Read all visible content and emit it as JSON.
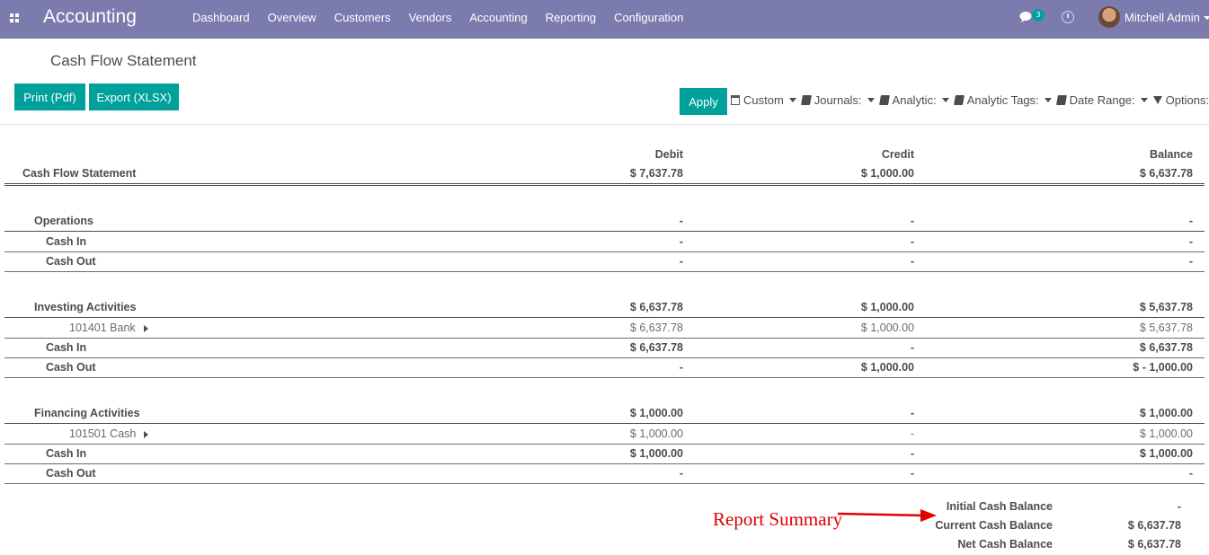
{
  "navbar": {
    "app_title": "Accounting",
    "menu": [
      "Dashboard",
      "Overview",
      "Customers",
      "Vendors",
      "Accounting",
      "Reporting",
      "Configuration"
    ],
    "chat_count": "3",
    "user_name": "Mitchell Admin"
  },
  "page": {
    "title": "Cash Flow Statement",
    "print_label": "Print (Pdf)",
    "export_label": "Export (XLSX)",
    "apply_label": "Apply",
    "filters": [
      "Custom",
      "Journals:",
      "Analytic:",
      "Analytic Tags:",
      "Date Range:",
      "Options:"
    ]
  },
  "report": {
    "columns": [
      "Debit",
      "Credit",
      "Balance"
    ],
    "rows": [
      {
        "label": "Cash Flow Statement",
        "debit": "$ 7,637.78",
        "credit": "$ 1,000.00",
        "balance": "$ 6,637.78",
        "style": "title"
      },
      {
        "label": "Operations",
        "debit": "-",
        "credit": "-",
        "balance": "-",
        "style": "section"
      },
      {
        "label": "Cash In",
        "debit": "-",
        "credit": "-",
        "balance": "-",
        "style": "sub"
      },
      {
        "label": "Cash Out",
        "debit": "-",
        "credit": "-",
        "balance": "-",
        "style": "sub"
      },
      {
        "label": "Investing Activities",
        "debit": "$ 6,637.78",
        "credit": "$ 1,000.00",
        "balance": "$ 5,637.78",
        "style": "section"
      },
      {
        "label": "101401 Bank",
        "debit": "$ 6,637.78",
        "credit": "$ 1,000.00",
        "balance": "$ 5,637.78",
        "style": "account"
      },
      {
        "label": "Cash In",
        "debit": "$ 6,637.78",
        "credit": "-",
        "balance": "$ 6,637.78",
        "style": "sub"
      },
      {
        "label": "Cash Out",
        "debit": "-",
        "credit": "$ 1,000.00",
        "balance": "$ - 1,000.00",
        "style": "sub"
      },
      {
        "label": "Financing Activities",
        "debit": "$ 1,000.00",
        "credit": "-",
        "balance": "$ 1,000.00",
        "style": "section"
      },
      {
        "label": "101501 Cash",
        "debit": "$ 1,000.00",
        "credit": "-",
        "balance": "$ 1,000.00",
        "style": "account"
      },
      {
        "label": "Cash In",
        "debit": "$ 1,000.00",
        "credit": "-",
        "balance": "$ 1,000.00",
        "style": "sub"
      },
      {
        "label": "Cash Out",
        "debit": "-",
        "credit": "-",
        "balance": "-",
        "style": "sub"
      }
    ],
    "summary": [
      {
        "label": "Initial Cash Balance",
        "value": "-"
      },
      {
        "label": "Current Cash Balance",
        "value": "$ 6,637.78"
      },
      {
        "label": "Net Cash Balance",
        "value": "$ 6,637.78"
      }
    ]
  },
  "annotation": {
    "text": "Report Summary",
    "color": "#e00000"
  },
  "colors": {
    "navbar": "#7c7bad",
    "primary_button": "#00a09d"
  }
}
